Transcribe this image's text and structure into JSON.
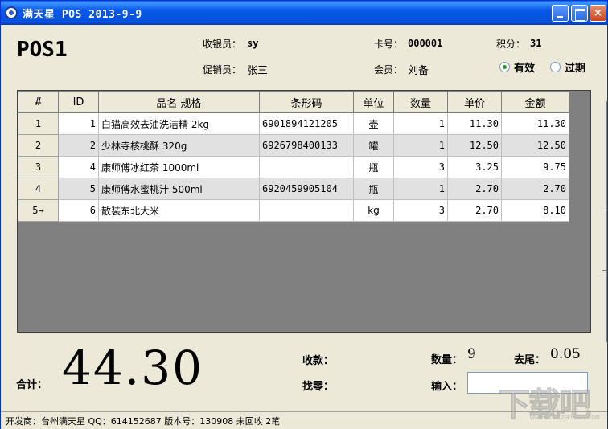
{
  "window": {
    "title": "满天星 POS 2013-9-9",
    "buttons": {
      "minimize": "_",
      "maximize": "□",
      "close": "×"
    }
  },
  "header": {
    "pos_name": "POS1",
    "cashier_label": "收银员：",
    "cashier_value": "sy",
    "card_label": "卡号：",
    "card_value": "000001",
    "points_label": "积分：",
    "points_value": "31",
    "promoter_label": "促销员：",
    "promoter_value": "张三",
    "member_label": "会员：",
    "member_value": "刘备",
    "status_options": [
      {
        "label": "有效",
        "checked": true
      },
      {
        "label": "过期",
        "checked": false
      }
    ]
  },
  "grid": {
    "columns": [
      "#",
      "ID",
      "品名 规格",
      "条形码",
      "单位",
      "数量",
      "单价",
      "金额"
    ],
    "rows": [
      {
        "rownum": "1",
        "id": "1",
        "name": "白猫高效去油洗洁精 2kg",
        "barcode": "6901894121205",
        "unit": "壶",
        "qty": "1",
        "price": "11.30",
        "amount": "11.30"
      },
      {
        "rownum": "2",
        "id": "2",
        "name": "少林寺核桃酥 320g",
        "barcode": "6926798400133",
        "unit": "罐",
        "qty": "1",
        "price": "12.50",
        "amount": "12.50"
      },
      {
        "rownum": "3",
        "id": "4",
        "name": "康师傅冰红茶 1000ml",
        "barcode": "",
        "unit": "瓶",
        "qty": "3",
        "price": "3.25",
        "amount": "9.75"
      },
      {
        "rownum": "4",
        "id": "5",
        "name": "康师傅水蜜桃汁 500ml",
        "barcode": "6920459905104",
        "unit": "瓶",
        "qty": "1",
        "price": "2.70",
        "amount": "2.70"
      },
      {
        "rownum": "5→",
        "id": "6",
        "name": "散装东北大米",
        "barcode": "",
        "unit": "kg",
        "qty": "3",
        "price": "2.70",
        "amount": "8.10"
      }
    ]
  },
  "footer": {
    "total_label": "合计：",
    "total_value": "44.30",
    "received_label": "收款：",
    "change_label": "找零：",
    "qty_label": "数量：",
    "qty_value": "9",
    "rounding_label": "去尾：",
    "rounding_value": "0.05",
    "input_label": "输入："
  },
  "statusbar": {
    "text": "开发商：台州满天星 QQ：614152687 版本号：130908 未回收 2笔"
  },
  "watermark": {
    "main": "下载吧",
    "url": "www.xiazaiba.com"
  },
  "colors": {
    "titlebar": "#0858e8",
    "window_bg": "#ece9d8",
    "grid_bg": "#808080",
    "row_alt": "#e1e1e1",
    "radio_dot": "#21a121"
  },
  "icons": [
    "app-icon",
    "minimize-icon",
    "maximize-icon",
    "close-icon",
    "row-pointer-icon"
  ]
}
